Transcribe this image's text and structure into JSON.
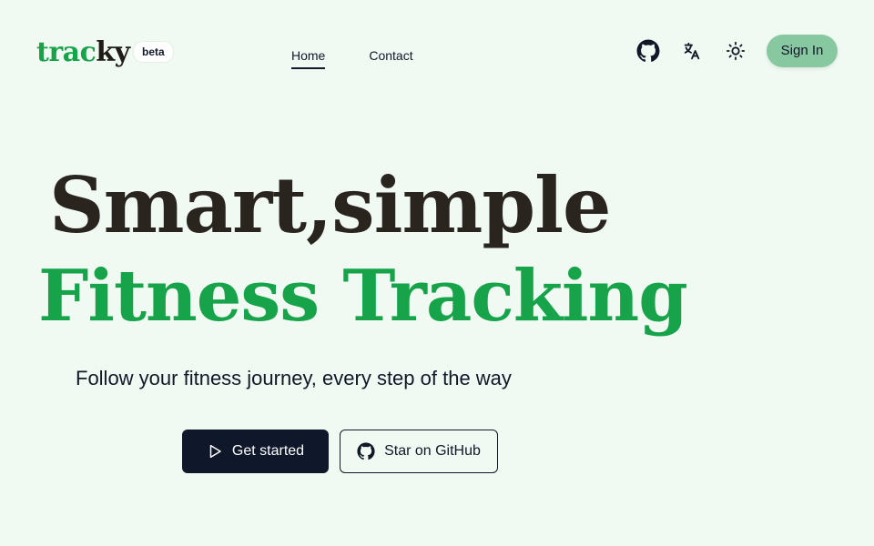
{
  "header": {
    "logo": {
      "part1": "trac",
      "part2": "ky"
    },
    "badge": "beta",
    "nav": [
      {
        "label": "Home",
        "active": true
      },
      {
        "label": "Contact",
        "active": false
      }
    ],
    "icons": [
      "github-icon",
      "translate-icon",
      "sun-icon"
    ],
    "signin_label": "Sign In"
  },
  "hero": {
    "line1": "Smart,simple",
    "line2": "Fitness Tracking",
    "subtitle": "Follow your fitness journey, every step of the way",
    "primary_button": {
      "label": "Get started",
      "icon": "play-icon"
    },
    "secondary_button": {
      "label": "Star on GitHub",
      "icon": "github-icon"
    }
  },
  "colors": {
    "background": "#f0faf3",
    "brand_green": "#16a34a",
    "signin_bg": "#88c8a0",
    "primary_button_bg": "#0f172a"
  }
}
